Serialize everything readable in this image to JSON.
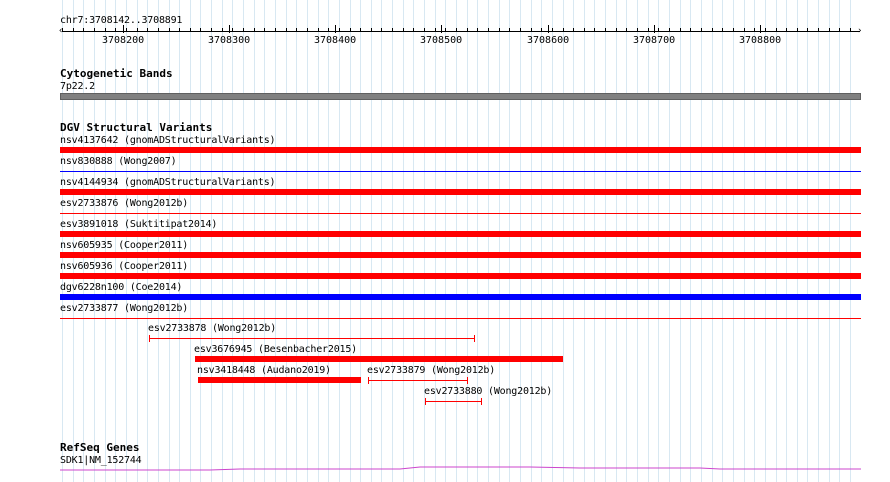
{
  "ruler": {
    "region": "chr7:3708142..3708891",
    "ticks": [
      "3708200",
      "3708300",
      "3708400",
      "3708500",
      "3708600",
      "3708700",
      "3708800"
    ]
  },
  "cytoband": {
    "title": "Cytogenetic Bands",
    "label": "7p22.2",
    "color": "#808080"
  },
  "dgv": {
    "title": "DGV Structural Variants",
    "colors": {
      "loss": "#ff0000",
      "gain": "#0000ff"
    },
    "rows": [
      {
        "label": "nsv4137642 (gnomADStructuralVariants)",
        "style": "bar",
        "color": "#ff0000"
      },
      {
        "label": "nsv830888 (Wong2007)",
        "style": "thin",
        "color": "#0000ff"
      },
      {
        "label": "nsv4144934 (gnomADStructuralVariants)",
        "style": "bar",
        "color": "#ff0000"
      },
      {
        "label": "esv2733876 (Wong2012b)",
        "style": "thin",
        "color": "#ff0000"
      },
      {
        "label": "esv3891018 (Suktitipat2014)",
        "style": "bar",
        "color": "#ff0000"
      },
      {
        "label": "nsv605935 (Cooper2011)",
        "style": "bar",
        "color": "#ff0000"
      },
      {
        "label": "nsv605936 (Cooper2011)",
        "style": "bar",
        "color": "#ff0000"
      },
      {
        "label": "dgv6228n100 (Coe2014)",
        "style": "bar",
        "color": "#0000ff"
      },
      {
        "label": "esv2733877 (Wong2012b)",
        "style": "thin",
        "color": "#ff0000"
      }
    ],
    "partial": [
      {
        "label": "esv2733878 (Wong2012b)",
        "style": "bracket",
        "color": "#ff0000"
      },
      {
        "label": "esv3676945 (Besenbacher2015)",
        "style": "bar",
        "color": "#ff0000"
      },
      {
        "label": "nsv3418448 (Audano2019)",
        "style": "bar",
        "color": "#ff0000"
      },
      {
        "label": "esv2733879 (Wong2012b)",
        "style": "bracket",
        "color": "#ff0000"
      },
      {
        "label": "esv2733880 (Wong2012b)",
        "style": "bracket",
        "color": "#ff0000"
      }
    ]
  },
  "refseq": {
    "title": "RefSeq Genes",
    "label": "SDK1|NM_152744",
    "color": "#cc44cc"
  }
}
